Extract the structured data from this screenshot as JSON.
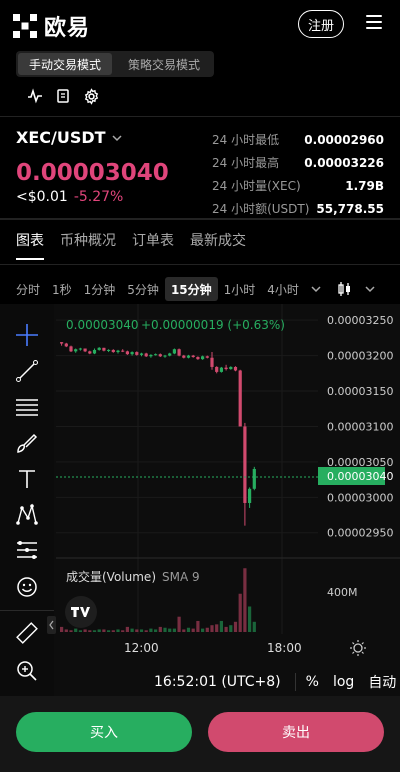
{
  "header": {
    "brand": "欧易",
    "register_label": "注册"
  },
  "modes": [
    "手动交易模式",
    "策略交易模式"
  ],
  "ticker": {
    "pair": "XEC/USDT",
    "price": "0.00003040",
    "usd": "<$0.01",
    "change": "-5.27%",
    "stats": [
      {
        "label": "24 小时最低",
        "value": "0.00002960"
      },
      {
        "label": "24 小时最高",
        "value": "0.00003226"
      },
      {
        "label": "24 小时量(XEC)",
        "value": "1.79B"
      },
      {
        "label": "24 小时额(USDT)",
        "value": "55,778.55"
      }
    ]
  },
  "tabs": [
    "图表",
    "币种概况",
    "订单表",
    "最新成交"
  ],
  "intervals": [
    "分时",
    "1秒",
    "1分钟",
    "5分钟",
    "15分钟",
    "1小时",
    "4小时"
  ],
  "chart": {
    "legend": {
      "price": "0.00003040",
      "change": "+0.00000019 (+0.63%)"
    },
    "volume_label": "成交量(Volume)",
    "volume_sma": "SMA 9",
    "volume_tick": "400M",
    "price_ticks": [
      "0.00003250",
      "0.00003200",
      "0.00003150",
      "0.00003100",
      "0.00003050",
      "0.00003000",
      "0.00002950"
    ],
    "last_price_tag": "0.00003040",
    "time_ticks": [
      "12:00",
      "18:00"
    ]
  },
  "chart_data": {
    "type": "candlestick",
    "y_range": [
      2.92e-05,
      3.27e-05
    ],
    "ohlc": [
      [
        3.219,
        3.219,
        3.214,
        3.217
      ],
      [
        3.217,
        3.218,
        3.212,
        3.213
      ],
      [
        3.213,
        3.214,
        3.205,
        3.206
      ],
      [
        3.206,
        3.21,
        3.204,
        3.209
      ],
      [
        3.209,
        3.211,
        3.207,
        3.21
      ],
      [
        3.21,
        3.21,
        3.205,
        3.206
      ],
      [
        3.206,
        3.207,
        3.202,
        3.203
      ],
      [
        3.203,
        3.21,
        3.202,
        3.208
      ],
      [
        3.208,
        3.212,
        3.207,
        3.211
      ],
      [
        3.211,
        3.211,
        3.206,
        3.207
      ],
      [
        3.207,
        3.209,
        3.205,
        3.208
      ],
      [
        3.208,
        3.209,
        3.204,
        3.205
      ],
      [
        3.205,
        3.208,
        3.203,
        3.207
      ],
      [
        3.207,
        3.209,
        3.205,
        3.206
      ],
      [
        3.206,
        3.207,
        3.201,
        3.202
      ],
      [
        3.202,
        3.206,
        3.2,
        3.205
      ],
      [
        3.205,
        3.206,
        3.2,
        3.201
      ],
      [
        3.201,
        3.204,
        3.199,
        3.203
      ],
      [
        3.203,
        3.204,
        3.198,
        3.199
      ],
      [
        3.199,
        3.202,
        3.197,
        3.201
      ],
      [
        3.201,
        3.203,
        3.2,
        3.202
      ],
      [
        3.202,
        3.203,
        3.198,
        3.199
      ],
      [
        3.199,
        3.201,
        3.197,
        3.2
      ],
      [
        3.2,
        3.204,
        3.199,
        3.203
      ],
      [
        3.203,
        3.21,
        3.202,
        3.209
      ],
      [
        3.209,
        3.21,
        3.199,
        3.2
      ],
      [
        3.2,
        3.201,
        3.196,
        3.197
      ],
      [
        3.197,
        3.201,
        3.196,
        3.2
      ],
      [
        3.2,
        3.201,
        3.197,
        3.198
      ],
      [
        3.198,
        3.199,
        3.194,
        3.195
      ],
      [
        3.195,
        3.2,
        3.194,
        3.199
      ],
      [
        3.199,
        3.2,
        3.196,
        3.197
      ],
      [
        3.197,
        3.205,
        3.18,
        3.184
      ],
      [
        3.184,
        3.185,
        3.175,
        3.177
      ],
      [
        3.177,
        3.184,
        3.176,
        3.183
      ],
      [
        3.183,
        3.187,
        3.179,
        3.181
      ],
      [
        3.181,
        3.185,
        3.18,
        3.184
      ],
      [
        3.184,
        3.185,
        3.178,
        3.179
      ],
      [
        3.179,
        3.18,
        3.1,
        3.1
      ],
      [
        3.1,
        3.105,
        2.96,
        2.992
      ],
      [
        2.992,
        3.014,
        2.985,
        3.012
      ],
      [
        3.012,
        3.043,
        3.01,
        3.04
      ]
    ],
    "volume": [
      6,
      3,
      2,
      4,
      2,
      3,
      2,
      2,
      3,
      3,
      2,
      2,
      3,
      2,
      6,
      4,
      3,
      3,
      2,
      4,
      3,
      6,
      5,
      4,
      4,
      18,
      3,
      5,
      4,
      13,
      4,
      5,
      8,
      9,
      13,
      6,
      8,
      12,
      45,
      75,
      30,
      12
    ]
  },
  "footer": {
    "time": "16:52:01 (UTC+8)",
    "percent": "%",
    "log": "log",
    "auto": "自动"
  },
  "actions": {
    "buy": "买入",
    "sell": "卖出"
  },
  "colors": {
    "up": "#27ae60",
    "down": "#d14a6e",
    "price_red": "#e0457b"
  }
}
